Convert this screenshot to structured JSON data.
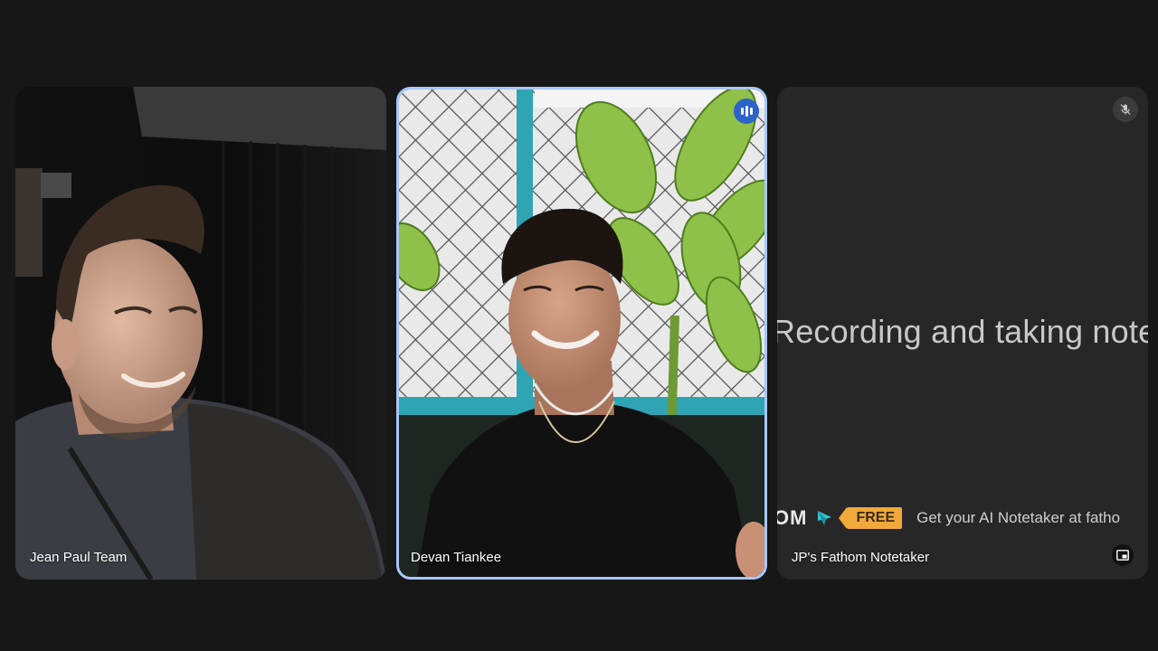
{
  "participants": [
    {
      "name": "Jean Paul Team"
    },
    {
      "name": "Devan Tiankee",
      "speaking": true
    },
    {
      "name": "JP's Fathom Notetaker",
      "heading": "Recording and taking notes",
      "brand": "OM",
      "badge": "FREE",
      "promo": "Get your AI Notetaker at fatho",
      "icons": [
        "mic-off-icon",
        "picture-in-picture-icon"
      ]
    }
  ],
  "colors": {
    "active_speaker_border": "#a8c7fa",
    "speaking_badge": "#2b63c9",
    "free_badge": "#f2a93b"
  }
}
